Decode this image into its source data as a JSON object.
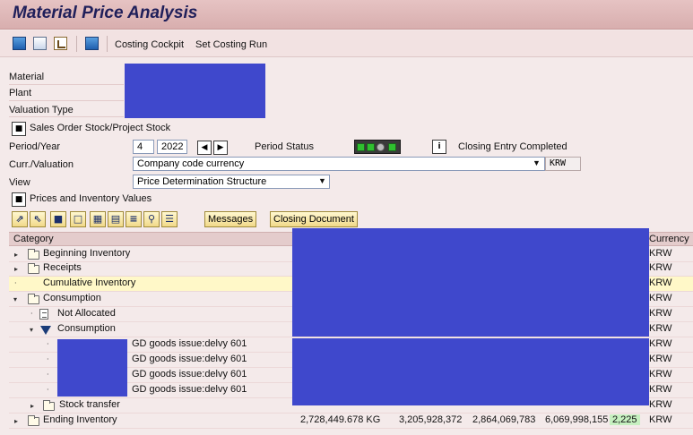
{
  "window": {
    "title": "Material Price Analysis"
  },
  "app_toolbar": {
    "costing_cockpit": "Costing Cockpit",
    "set_costing_run": "Set Costing Run"
  },
  "header": {
    "material_label": "Material",
    "plant_label": "Plant",
    "valuation_type_label": "Valuation Type",
    "sales_order_stock_label": "Sales Order Stock/Project Stock",
    "period_year_label": "Period/Year",
    "period": "4",
    "year": "2022",
    "period_status_label": "Period Status",
    "closing_status": "Closing Entry Completed",
    "curr_valuation_label": "Curr./Valuation",
    "currency_valuation": "Company code currency",
    "currency_code": "KRW",
    "view_label": "View",
    "view_value": "Price Determination Structure",
    "prices_inventory_label": "Prices and Inventory Values"
  },
  "table_toolbar": {
    "messages": "Messages",
    "closing_document": "Closing Document"
  },
  "table": {
    "col_category": "Category",
    "col_currency": "Currency",
    "rows": [
      {
        "label": "Beginning Inventory",
        "currency": "KRW"
      },
      {
        "label": "Receipts",
        "currency": "KRW"
      },
      {
        "label": "Cumulative Inventory",
        "currency": "KRW"
      },
      {
        "label": "Consumption",
        "currency": "KRW"
      },
      {
        "label": "Not Allocated",
        "currency": "KRW"
      },
      {
        "label": "Consumption",
        "currency": "KRW"
      },
      {
        "label": "GD goods issue:delvy 601",
        "currency": "KRW"
      },
      {
        "label": "GD goods issue:delvy 601",
        "currency": "KRW"
      },
      {
        "label": "GD goods issue:delvy 601",
        "currency": "KRW"
      },
      {
        "label": "GD goods issue:delvy 601",
        "currency": "KRW"
      },
      {
        "label": "Stock transfer",
        "currency": "KRW"
      },
      {
        "label": "Ending Inventory",
        "currency": "KRW"
      }
    ],
    "ending": {
      "quantity": "2,728,449.678 KG",
      "value1": "3,205,928,372",
      "value2": "2,864,069,783",
      "value3": "6,069,998,155",
      "price": "2,225"
    }
  },
  "colors": {
    "redaction": "#3f48cc",
    "highlight_row": "#fff8c8",
    "price_cell": "#c6f0c0"
  }
}
